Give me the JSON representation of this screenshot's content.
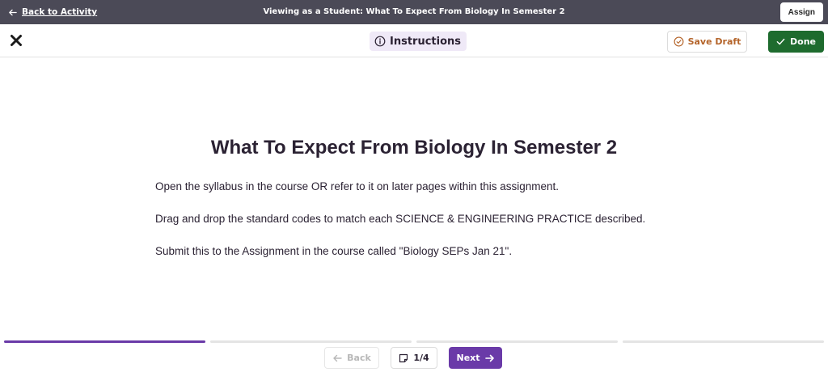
{
  "topbar": {
    "back_label": "Back to Activity",
    "viewing_title": "Viewing as a Student: What To Expect From Biology In Semester 2",
    "assign_label": "Assign"
  },
  "subbar": {
    "close_icon": "close-icon",
    "instructions_label": "Instructions",
    "save_draft_label": "Save Draft",
    "done_label": "Done"
  },
  "content": {
    "title": "What To Expect From Biology In Semester 2",
    "paragraphs": [
      "Open the syllabus in the course OR refer to it on later pages within this assignment.",
      "Drag and drop the standard codes to match each SCIENCE & ENGINEERING PRACTICE described.",
      "Submit this to the Assignment in the course called \"Biology SEPs Jan 21\"."
    ]
  },
  "progress": {
    "segments": 4,
    "current_segment": 1
  },
  "footer": {
    "back_label": "Back",
    "page_counter": "1/4",
    "next_label": "Next"
  },
  "colors": {
    "topbar_bg": "#4b4a57",
    "accent_purple": "#6a3aa8",
    "done_green": "#1e6b2e",
    "save_draft_orange": "#b4642a",
    "instructions_bg": "#efe9f7"
  }
}
